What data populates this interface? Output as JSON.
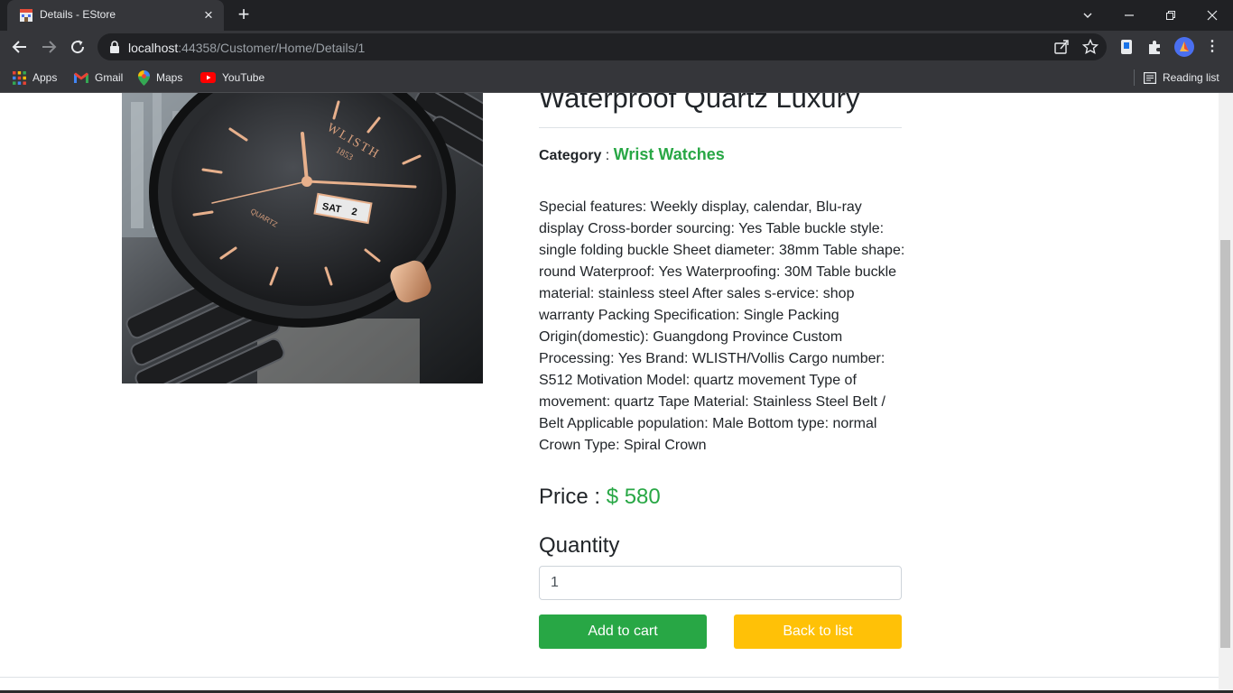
{
  "browser": {
    "tab_title": "Details - EStore",
    "url_host": "localhost",
    "url_path": ":44358/Customer/Home/Details/1",
    "bookmarks": [
      {
        "label": "Apps",
        "icon": "apps-grid-icon"
      },
      {
        "label": "Gmail",
        "icon": "gmail-icon"
      },
      {
        "label": "Maps",
        "icon": "maps-icon"
      },
      {
        "label": "YouTube",
        "icon": "youtube-icon"
      }
    ],
    "reading_list": "Reading list"
  },
  "product": {
    "title": "Waterproof Quartz Luxury",
    "category_label": "Category",
    "category_separator": " : ",
    "category_value": "Wrist Watches",
    "description": "Special features: Weekly display, calendar, Blu-ray display Cross-border sourcing: Yes Table buckle style: single folding buckle Sheet diameter: 38mm Table shape: round Waterproof: Yes Waterproofing: 30M Table buckle material: stainless steel After sales s-ervice: shop warranty Packing Specification: Single Packing Origin(domestic): Guangdong Province Custom Processing: Yes Brand: WLISTH/Vollis Cargo number: S512 Motivation Model: quartz movement Type of movement: quartz Tape Material: Stainless Steel Belt / Belt Applicable population: Male Bottom type: normal Crown Type: Spiral Crown",
    "price_label": "Price : ",
    "price_value": "$ 580",
    "quantity_label": "Quantity",
    "quantity_value": "1",
    "add_to_cart_label": "Add to cart",
    "back_to_list_label": "Back to list"
  },
  "watch_image": {
    "brand": "WLISTH",
    "year": "1853",
    "dial_text": "QUARTZ",
    "day": "SAT",
    "date": "2"
  },
  "colors": {
    "accent_green": "#28a745",
    "button_yellow": "#ffc107",
    "chrome_dark": "#202124",
    "chrome_toolbar": "#35363a"
  }
}
